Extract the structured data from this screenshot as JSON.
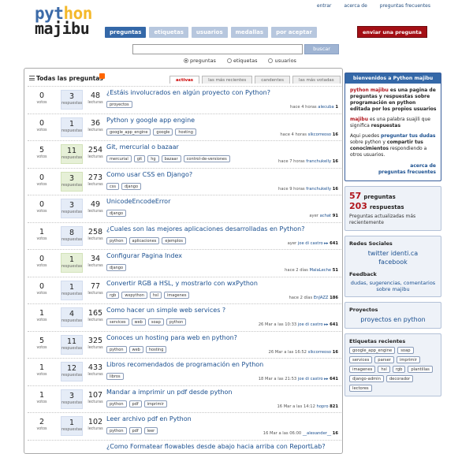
{
  "logo": {
    "line1_a": "pyt",
    "line1_b": "hon",
    "line2": "majibu"
  },
  "toplinks": [
    "entrar",
    "acerca de",
    "preguntas frecuentes"
  ],
  "nav": [
    {
      "label": "preguntas",
      "active": true
    },
    {
      "label": "etiquetas",
      "active": false
    },
    {
      "label": "usuarios",
      "active": false
    },
    {
      "label": "medallas",
      "active": false
    },
    {
      "label": "por aceptar",
      "active": false
    }
  ],
  "ask_button": "enviar una pregunta",
  "search": {
    "placeholder": "",
    "button": "buscar",
    "options": [
      "preguntas",
      "etiquetas",
      "usuarios"
    ],
    "selected": "preguntas"
  },
  "list": {
    "heading": "Todas las preguntas",
    "sort_tabs": [
      "activas",
      "las más recientes",
      "candentes",
      "las más votadas"
    ],
    "active_tab": "activas",
    "votes_label": "votos",
    "answers_label": "respuestas",
    "views_label": "lecturas",
    "questions": [
      {
        "votes": "0",
        "answers": "3",
        "views": "48",
        "accepted": false,
        "title": "¿Estáis involucrados en algún proyecto con Python?",
        "tags": [
          "proyectos"
        ],
        "meta": "hace 4 horas ",
        "user": "alecuba",
        "rep": "1"
      },
      {
        "votes": "0",
        "answers": "1",
        "views": "36",
        "accepted": false,
        "title": "Python y google app engine",
        "tags": [
          "google_app_engine",
          "google",
          "hosting"
        ],
        "meta": "hace 4 horas ",
        "user": "slkcorreoso",
        "rep": "16"
      },
      {
        "votes": "5",
        "answers": "11",
        "views": "254",
        "accepted": true,
        "title": "Git, mercurial o bazaar",
        "tags": [
          "mercurial",
          "git",
          "hg",
          "bazaar",
          "control-de-versiones"
        ],
        "meta": "hace 7 horas ",
        "user": "franchukelly",
        "rep": "16"
      },
      {
        "votes": "0",
        "answers": "3",
        "views": "273",
        "accepted": true,
        "title": "Como usar CSS en Django?",
        "tags": [
          "css",
          "django"
        ],
        "meta": "hace 9 horas ",
        "user": "franchukelly",
        "rep": "16"
      },
      {
        "votes": "0",
        "answers": "3",
        "views": "49",
        "accepted": false,
        "title": "UnicodeEncodeError",
        "tags": [
          "django"
        ],
        "meta": "ayer ",
        "user": "achat",
        "rep": "91"
      },
      {
        "votes": "1",
        "answers": "8",
        "views": "258",
        "accepted": false,
        "title": "¿Cuales son las mejores aplicaciones desarrolladas en Python?",
        "tags": [
          "python",
          "aplicaciones",
          "ejemplos"
        ],
        "meta": "ayer ",
        "user": "joe di castro ▸▸",
        "rep": "641"
      },
      {
        "votes": "0",
        "answers": "1",
        "views": "34",
        "accepted": true,
        "title": "Configurar Pagina Index",
        "tags": [
          "django"
        ],
        "meta": "hace 2 días ",
        "user": "MalaLeche",
        "rep": "51"
      },
      {
        "votes": "0",
        "answers": "1",
        "views": "77",
        "accepted": false,
        "title": "Convertir RGB a HSL, y mostrarlo con wxPython",
        "tags": [
          "rgb",
          "wxpython",
          "hsl",
          "imagenes"
        ],
        "meta": "hace 2 días ",
        "user": "EnJAZZ",
        "rep": "186"
      },
      {
        "votes": "1",
        "answers": "4",
        "views": "165",
        "accepted": false,
        "title": "Como hacer un simple web services ?",
        "tags": [
          "services",
          "web",
          "soap",
          "python"
        ],
        "meta": "26 Mar a las 10:33 ",
        "user": "joe di castro ▸▸",
        "rep": "641"
      },
      {
        "votes": "5",
        "answers": "11",
        "views": "325",
        "accepted": false,
        "title": "Conoces un hosting para web en python?",
        "tags": [
          "python",
          "web",
          "hosting"
        ],
        "meta": "26 Mar a las 16:52 ",
        "user": "slkcorreoso",
        "rep": "16"
      },
      {
        "votes": "1",
        "answers": "12",
        "views": "433",
        "accepted": false,
        "title": "Libros recomendados de programación en Python",
        "tags": [
          "libros"
        ],
        "meta": "18 Mar a las 21:53 ",
        "user": "joe di castro ▸▸",
        "rep": "641"
      },
      {
        "votes": "1",
        "answers": "3",
        "views": "107",
        "accepted": false,
        "title": "Mandar a imprimir un pdf desde python",
        "tags": [
          "python",
          "pdf",
          "imprimir"
        ],
        "meta": "16 Mar a las 14:12 ",
        "user": "hopro",
        "rep": "821"
      },
      {
        "votes": "2",
        "answers": "1",
        "views": "102",
        "accepted": false,
        "title": "Leer archivo pdf en Python",
        "tags": [
          "python",
          "pdf",
          "leer"
        ],
        "meta": "16 Mar a las 06:00 ",
        "user": "__alexander__",
        "rep": "16"
      },
      {
        "votes": "",
        "answers": "",
        "views": "",
        "accepted": false,
        "title": "¿Como Formatear flowables desde abajo hacia arriba con ReportLab?",
        "tags": [],
        "meta": "",
        "user": "",
        "rep": ""
      }
    ]
  },
  "welcome": {
    "header": "bienvenidos a Python majibu",
    "p1_bold": "python majibu",
    "p1_rest": " es una pagina de preguntas y respuestas sobre programación en python editada por los propios usuarios",
    "p2_bold": "majibu",
    "p2_rest": " es una palabra suajili que significa ",
    "p2_end": "respuestas",
    "p3_a": "Aqui puedes ",
    "p3_link": "preguntar tus dudas",
    "p3_b": " sobre python y ",
    "p3_strong": "compartir tus conocimientos",
    "p3_c": " respondiendo a otros usuarios.",
    "footer_link": "acerca de",
    "footer_link2": "preguntas frecuentes"
  },
  "stats": {
    "questions": "57",
    "questions_label": "preguntas",
    "answers": "203",
    "answers_label": "respuestas",
    "sub": "Preguntas actualizadas más recientemente"
  },
  "social": {
    "heading": "Redes Sociales",
    "links": [
      "twitter identi.ca",
      "facebook"
    ]
  },
  "feedback": {
    "heading": "Feedback",
    "text": "dudas, sugerencias, comentarios sobre majibu"
  },
  "projects": {
    "heading": "Proyectos",
    "link": "proyectos en python"
  },
  "recent_tags": {
    "heading": "Etiquetas recientes",
    "tags": [
      "google_app_engine",
      "soap",
      "services",
      "parser",
      "imprimir",
      "imagenes",
      "hsl",
      "rgb",
      "plantillas",
      "django-admin",
      "decorador",
      "lectores"
    ]
  },
  "colors": {
    "accent": "#3468a8",
    "ask_button": "#a40f15",
    "answers_bg": "#e5ecf7",
    "accepted_bg": "#e6f0d7"
  }
}
